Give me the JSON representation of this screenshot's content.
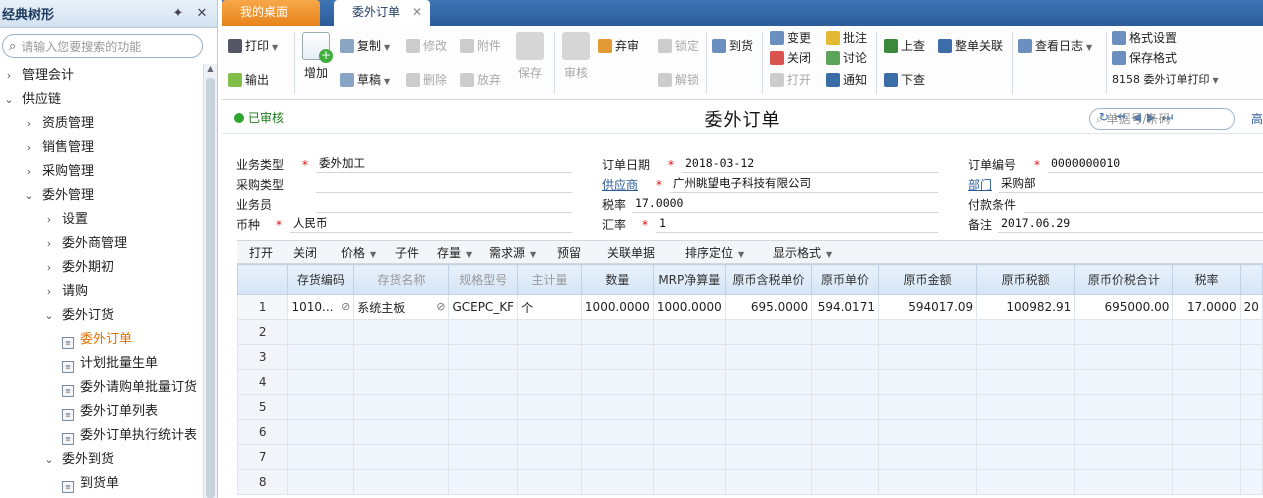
{
  "sidebar": {
    "title": "经典树形",
    "search_placeholder": "请输入您要搜索的功能",
    "items": [
      {
        "label": "管理会计",
        "arrow": "›",
        "indent": 0
      },
      {
        "label": "供应链",
        "arrow": "⌄",
        "indent": 0
      },
      {
        "label": "资质管理",
        "arrow": "›",
        "indent": 1
      },
      {
        "label": "销售管理",
        "arrow": "›",
        "indent": 1
      },
      {
        "label": "采购管理",
        "arrow": "›",
        "indent": 1
      },
      {
        "label": "委外管理",
        "arrow": "⌄",
        "indent": 1
      },
      {
        "label": "设置",
        "arrow": "›",
        "indent": 2
      },
      {
        "label": "委外商管理",
        "arrow": "›",
        "indent": 2
      },
      {
        "label": "委外期初",
        "arrow": "›",
        "indent": 2
      },
      {
        "label": "请购",
        "arrow": "›",
        "indent": 2
      },
      {
        "label": "委外订货",
        "arrow": "⌄",
        "indent": 2
      },
      {
        "label": "委外订单",
        "arrow": "",
        "indent": 3,
        "selected": true
      },
      {
        "label": "计划批量生单",
        "arrow": "",
        "indent": 3
      },
      {
        "label": "委外请购单批量订货",
        "arrow": "",
        "indent": 3
      },
      {
        "label": "委外订单列表",
        "arrow": "",
        "indent": 3
      },
      {
        "label": "委外订单执行统计表",
        "arrow": "",
        "indent": 3
      },
      {
        "label": "委外到货",
        "arrow": "⌄",
        "indent": 2
      },
      {
        "label": "到货单",
        "arrow": "",
        "indent": 3
      }
    ]
  },
  "tabs": {
    "home": "我的桌面",
    "active": "委外订单"
  },
  "toolbar": {
    "print": "打印",
    "export": "输出",
    "add": "增加",
    "copy": "复制",
    "draft": "草稿",
    "modify": "修改",
    "delete": "删除",
    "attach": "附件",
    "abandon": "放弃",
    "save": "保存",
    "audit": "审核",
    "unaudit": "弃审",
    "lock": "锁定",
    "unlock": "解锁",
    "arrival": "到货",
    "change": "变更",
    "close": "关闭",
    "open": "打开",
    "annotate": "批注",
    "discuss": "讨论",
    "notify": "通知",
    "prev": "上查",
    "next": "下查",
    "whole_link": "整单关联",
    "log": "查看日志",
    "format_setting": "格式设置",
    "save_format": "保存格式",
    "print_template": "8158 委外订单打印"
  },
  "header": {
    "status": "已审核",
    "title": "委外订单",
    "search_placeholder": "单据号/条码",
    "more": "高"
  },
  "form": {
    "business_type_label": "业务类型",
    "business_type": "委外加工",
    "purchase_type_label": "采购类型",
    "purchase_type": "",
    "salesman_label": "业务员",
    "salesman": "",
    "currency_label": "币种",
    "currency": "人民币",
    "order_date_label": "订单日期",
    "order_date": "2018-03-12",
    "supplier_label": "供应商",
    "supplier": "广州眺望电子科技有限公司",
    "tax_rate_label": "税率",
    "tax_rate": "17.0000",
    "exchange_rate_label": "汇率",
    "exchange_rate": "1",
    "order_no_label": "订单编号",
    "order_no": "0000000010",
    "department_label": "部门",
    "department": "采购部",
    "payment_terms_label": "付款条件",
    "payment_terms": "",
    "remark_label": "备注",
    "remark": "2017.06.29"
  },
  "gridbar": {
    "open": "打开",
    "close": "关闭",
    "price": "价格",
    "child": "子件",
    "stock": "存量",
    "demand": "需求源",
    "reserve": "预留",
    "related": "关联单据",
    "sort": "排序定位",
    "display": "显示格式"
  },
  "grid": {
    "columns": [
      "",
      "存货编码",
      "存货名称",
      "规格型号",
      "主计量",
      "数量",
      "MRP净算量",
      "原币含税单价",
      "原币单价",
      "原币金额",
      "原币税额",
      "原币价税合计",
      "税率",
      ""
    ],
    "rows": [
      {
        "no": "1",
        "code": "1010...",
        "name": "系统主板",
        "spec": "GCEPC_KF",
        "unit": "个",
        "qty": "1000.0000",
        "mrp": "1000.0000",
        "tax_price": "695.0000",
        "price": "594.0171",
        "amount": "594017.09",
        "tax": "100982.91",
        "total": "695000.00",
        "rate": "17.0000",
        "extra": "20"
      },
      {
        "no": "2"
      },
      {
        "no": "3"
      },
      {
        "no": "4"
      },
      {
        "no": "5"
      },
      {
        "no": "6"
      },
      {
        "no": "7"
      },
      {
        "no": "8"
      }
    ]
  }
}
